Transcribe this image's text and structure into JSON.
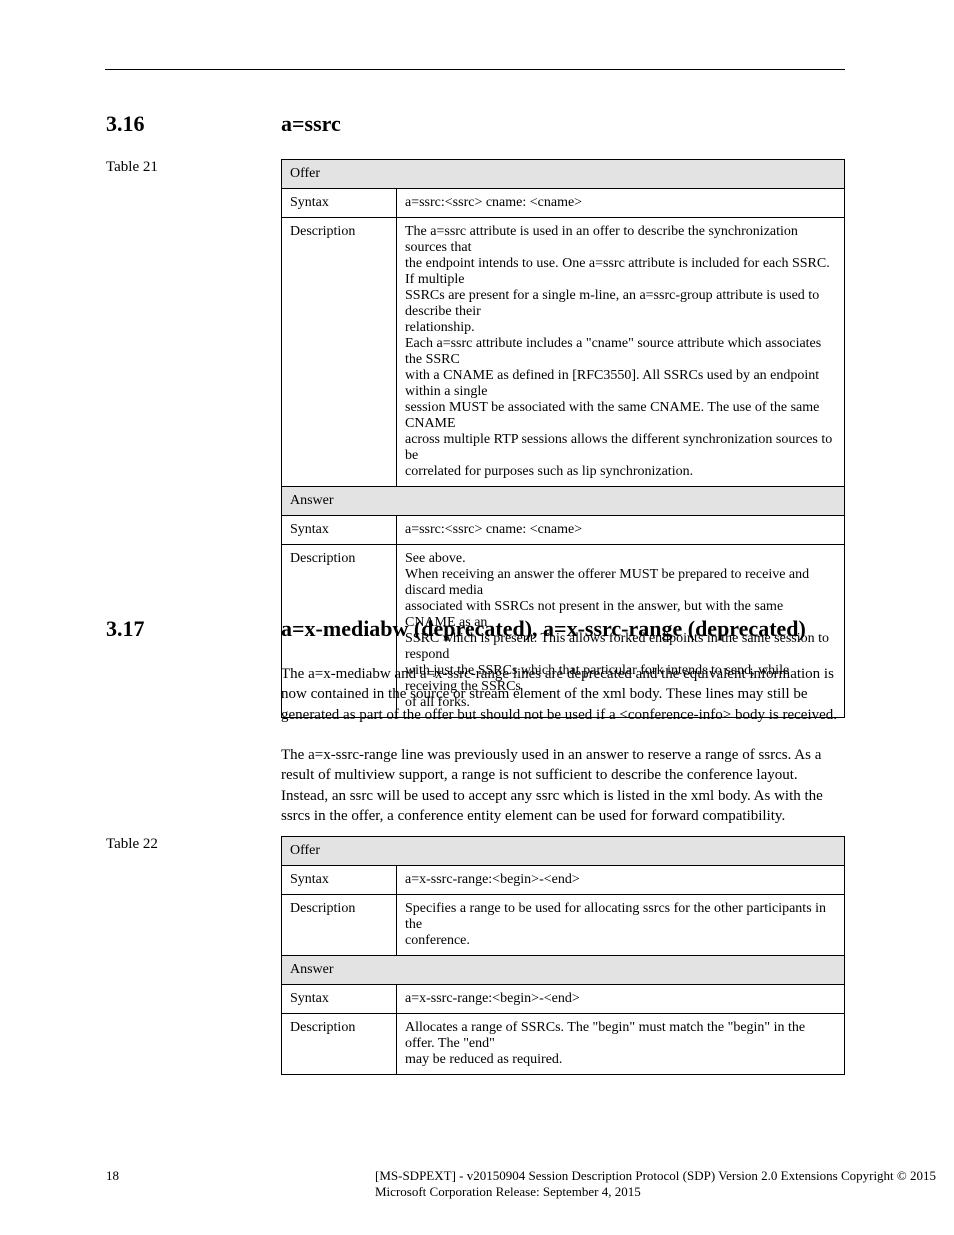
{
  "section_ssrc": {
    "number": "3.16",
    "title": "a=ssrc",
    "caption": "Table 21",
    "table": {
      "head1": "Offer",
      "r1c1": "Syntax",
      "r1c2": "a=ssrc:<ssrc> cname: <cname>",
      "r2c1": "Description",
      "r2c2_l1": "The a=ssrc attribute is used in an offer to describe the synchronization sources that",
      "r2c2_l2": "the endpoint intends to use. One a=ssrc attribute is included for each SSRC. If multiple",
      "r2c2_l3": "SSRCs are present for a single m-line, an a=ssrc-group attribute is used to describe their",
      "r2c2_l4": "relationship.",
      "r2c2_l5": "Each a=ssrc attribute includes a \"cname\" source attribute which associates the SSRC",
      "r2c2_l6": "with a CNAME as defined in [RFC3550]. All SSRCs used by an endpoint within a single",
      "r2c2_l7": "session MUST be associated with the same CNAME. The use of the same CNAME",
      "r2c2_l8": "across multiple RTP sessions allows the different synchronization sources to be",
      "r2c2_l9": "correlated for purposes such as lip synchronization.",
      "head2": "Answer",
      "r3c1": "Syntax",
      "r3c2": "a=ssrc:<ssrc> cname: <cname>",
      "r4c1": "Description",
      "r4c2_l1": "See above.",
      "r4c2_l2": "When receiving an answer the offerer MUST be prepared to receive and discard media",
      "r4c2_l3": "associated with SSRCs not present in the answer, but with the same CNAME as an",
      "r4c2_l4": "SSRC which is present. This allows forked endpoints in the same session to respond",
      "r4c2_l5": "with just the SSRCs which that particular fork intends to send, while receiving the SSRCs",
      "r4c2_l6": "of all forks."
    }
  },
  "section_stream": {
    "number": "3.17",
    "title": "a=x-mediabw (deprecated), a=x-ssrc-range (deprecated)",
    "desc": {
      "p1": "The a=x-mediabw and a=x-ssrc-range lines are deprecated and the equivalent information is now contained in the source or stream element of the xml body. These lines may still be generated as part of the offer but should not be used if a <conference-info> body is received.",
      "p2": "The a=x-ssrc-range line was previously used in an answer to reserve a range of ssrcs. As a result of multiview support, a range is not sufficient to describe the conference layout. Instead, an ssrc will be used to accept any ssrc which is listed in the xml body. As with the ssrcs in the offer, a conference entity element can be used for forward compatibility."
    },
    "caption": "Table 22",
    "table": {
      "head1": "Offer",
      "r1c1": "Syntax",
      "r1c2": "a=x-ssrc-range:<begin>-<end>",
      "r2c1": "Description",
      "r2c2_l1": "Specifies a range to be used for allocating ssrcs for the other participants in the",
      "r2c2_l2": "conference.",
      "head2": "Answer",
      "r3c1": "Syntax",
      "r3c2": "a=x-ssrc-range:<begin>-<end>",
      "r4c1": "Description",
      "r4c2_l1": "Allocates a range of SSRCs. The \"begin\" must match the \"begin\" in the offer. The \"end\"",
      "r4c2_l2": "may be reduced as required."
    }
  },
  "footer": {
    "page": "18",
    "doc": "[MS-SDPEXT] - v20150904\nSession Description Protocol (SDP) Version 2.0 Extensions\nCopyright © 2015 Microsoft Corporation\nRelease: September 4, 2015",
    "id": ""
  }
}
